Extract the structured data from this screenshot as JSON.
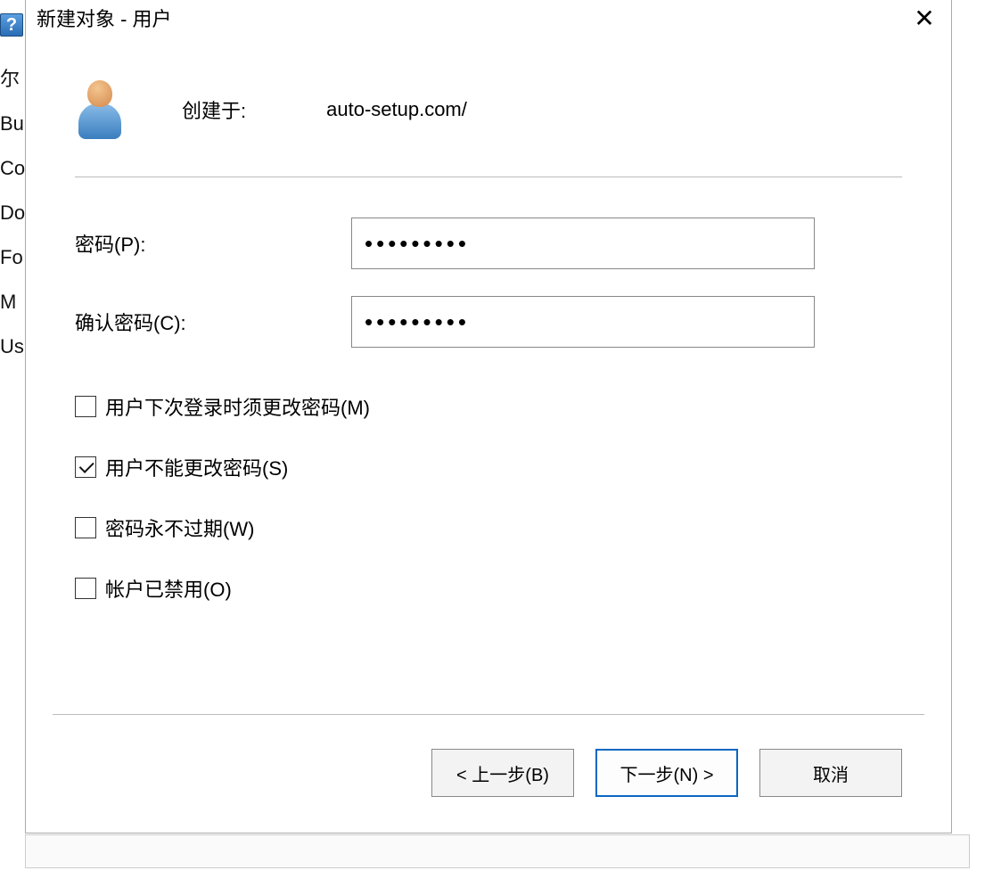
{
  "background_items": [
    "尔",
    "Bu",
    "Co",
    "Do",
    "Fo",
    "M",
    "Us"
  ],
  "titlebar": {
    "title": "新建对象 - 用户"
  },
  "header": {
    "created_label": "创建于:",
    "created_value": "auto-setup.com/"
  },
  "form": {
    "password_label": "密码(P):",
    "password_value": "•••••••••",
    "confirm_label": "确认密码(C):",
    "confirm_value": "•••••••••"
  },
  "checkboxes": [
    {
      "label": "用户下次登录时须更改密码(M)",
      "checked": false
    },
    {
      "label": "用户不能更改密码(S)",
      "checked": true
    },
    {
      "label": "密码永不过期(W)",
      "checked": false
    },
    {
      "label": "帐户已禁用(O)",
      "checked": false
    }
  ],
  "buttons": {
    "back": "< 上一步(B)",
    "next": "下一步(N) >",
    "cancel": "取消"
  }
}
